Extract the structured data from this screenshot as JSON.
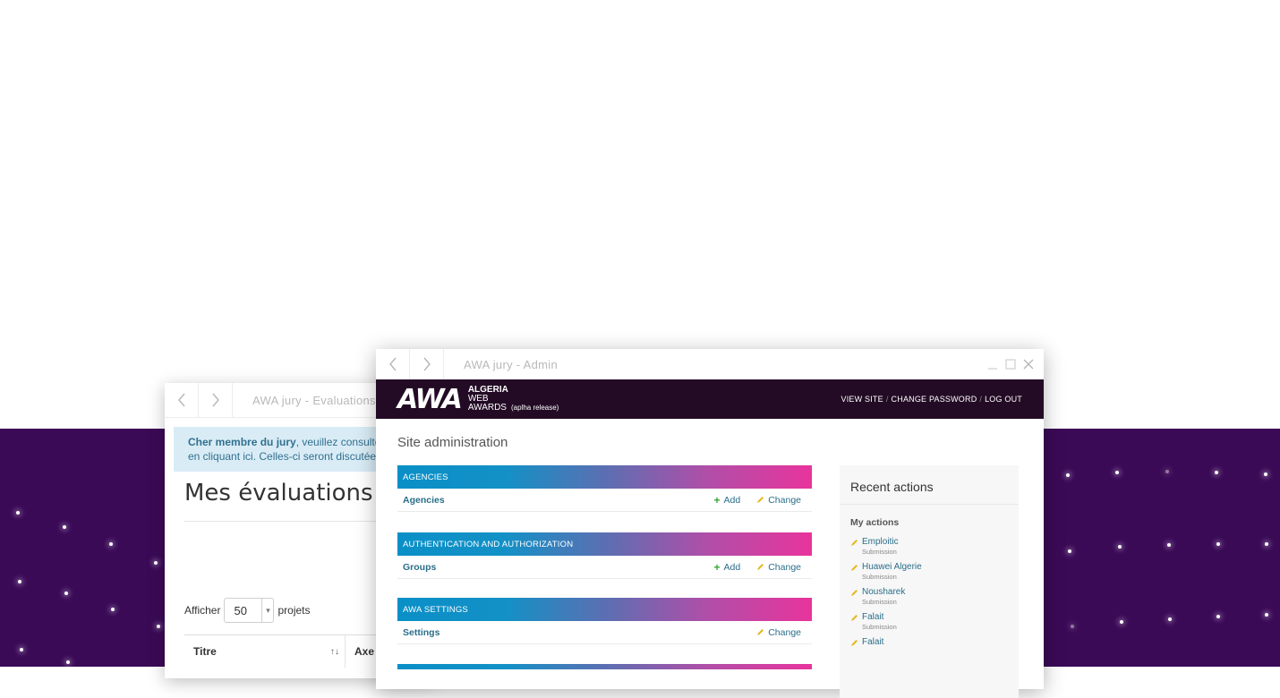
{
  "back_window": {
    "title": "AWA jury - Evaluations",
    "alert": {
      "bold": "Cher membre du jury",
      "line1_rest": ", veuillez consulter les directives d'évaluation",
      "line2": "en cliquant ici. Celles-ci seront discutées"
    },
    "heading": "Mes évaluations",
    "show_prefix": "Afficher",
    "page_size": "50",
    "show_suffix": "projets",
    "columns": [
      "Titre",
      "Axe"
    ]
  },
  "front_window": {
    "title": "AWA jury - Admin",
    "logo": {
      "mark": "AWA",
      "line1": "ALGERIA",
      "line2": "WEB",
      "line3": "AWARDS",
      "tag": "(aplha release)"
    },
    "user_tools": {
      "view_site": "VIEW SITE",
      "change_password": "CHANGE PASSWORD",
      "log_out": "LOG OUT"
    },
    "site_admin_title": "Site administration",
    "modules": [
      {
        "caption": "AGENCIES",
        "model": "Agencies",
        "add": "Add",
        "change": "Change"
      },
      {
        "caption": "AUTHENTICATION AND AUTHORIZATION",
        "model": "Groups",
        "add": "Add",
        "change": "Change"
      },
      {
        "caption": "AWA SETTINGS",
        "model": "Settings",
        "change": "Change"
      }
    ],
    "recent_actions": {
      "title": "Recent actions",
      "subtitle": "My actions",
      "items": [
        {
          "name": "Emploitic",
          "type": "Submission"
        },
        {
          "name": "Huawei Algerie",
          "type": "Submission"
        },
        {
          "name": "Nousharek",
          "type": "Submission"
        },
        {
          "name": "Falait",
          "type": "Submission"
        },
        {
          "name": "Falait",
          "type": ""
        }
      ]
    }
  },
  "colors": {
    "background_band": "#3b0a57",
    "header": "#230b25",
    "link": "#2a6e8a",
    "gradient_start": "#0a8fc7",
    "gradient_end": "#e8349c"
  }
}
